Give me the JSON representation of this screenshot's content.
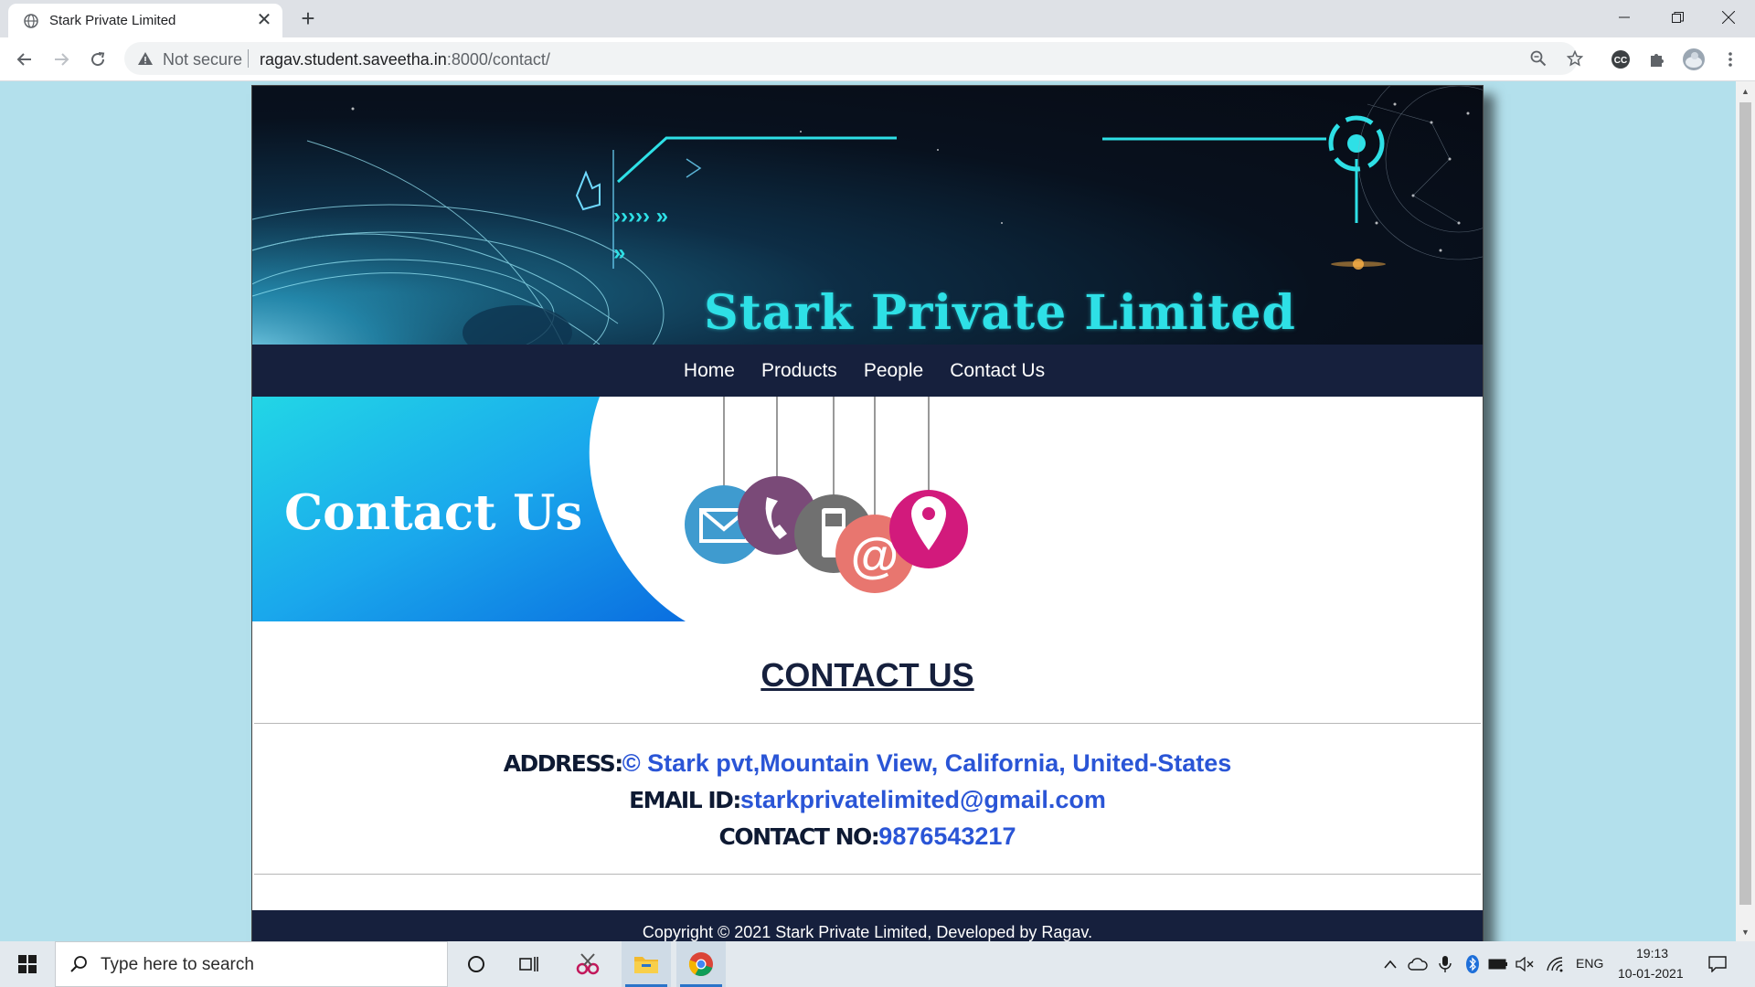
{
  "browser": {
    "tab_title": "Stark Private Limited",
    "tab_close": "✕",
    "new_tab": "+",
    "not_secure": "Not secure",
    "url_host": "ragav.student.saveetha.in",
    "url_path": ":8000/contact/"
  },
  "site": {
    "banner_title": "Stark Private Limited",
    "nav": [
      "Home",
      "Products",
      "People",
      "Contact Us"
    ],
    "hero_text": "Contact Us",
    "heading": "CONTACT US",
    "address_label": "ADDRESS:",
    "address_value": "© Stark pvt,Mountain View, California, United-States",
    "email_label": "EMAIL ID:",
    "email_value": "starkprivatelimited@gmail.com",
    "contact_label": "CONTACT NO:",
    "contact_value": "9876543217",
    "footer": "Copyright © 2021 Stark Private Limited, Developed by Ragav."
  },
  "taskbar": {
    "search_placeholder": "Type here to search",
    "lang": "ENG",
    "time": "19:13",
    "date": "10-01-2021"
  },
  "colors": {
    "page_bg": "#b3e0ec",
    "nav_bg": "#16203d",
    "banner_title": "#2ee0e6",
    "link_blue": "#2a55d6",
    "label_dark": "#0e1a33"
  }
}
